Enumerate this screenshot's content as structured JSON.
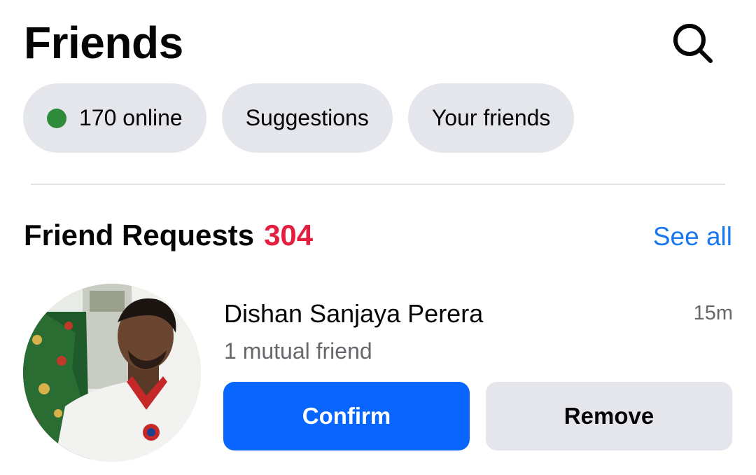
{
  "header": {
    "title": "Friends",
    "search_icon": "search-icon"
  },
  "chips": {
    "online_label": "170 online",
    "online_dot_color": "#2e8b3a",
    "suggestions_label": "Suggestions",
    "your_friends_label": "Your friends"
  },
  "requests": {
    "title": "Friend Requests",
    "count": "304",
    "count_color": "#e41e3f",
    "see_all_label": "See all",
    "items": [
      {
        "name": "Dishan Sanjaya Perera",
        "time": "15m",
        "mutual": "1 mutual friend",
        "confirm_label": "Confirm",
        "remove_label": "Remove",
        "avatar_icon": "profile-photo"
      }
    ]
  },
  "colors": {
    "accent": "#0866ff",
    "link": "#1877f2",
    "chip_bg": "#e4e6eb",
    "secondary_text": "#65676b"
  }
}
